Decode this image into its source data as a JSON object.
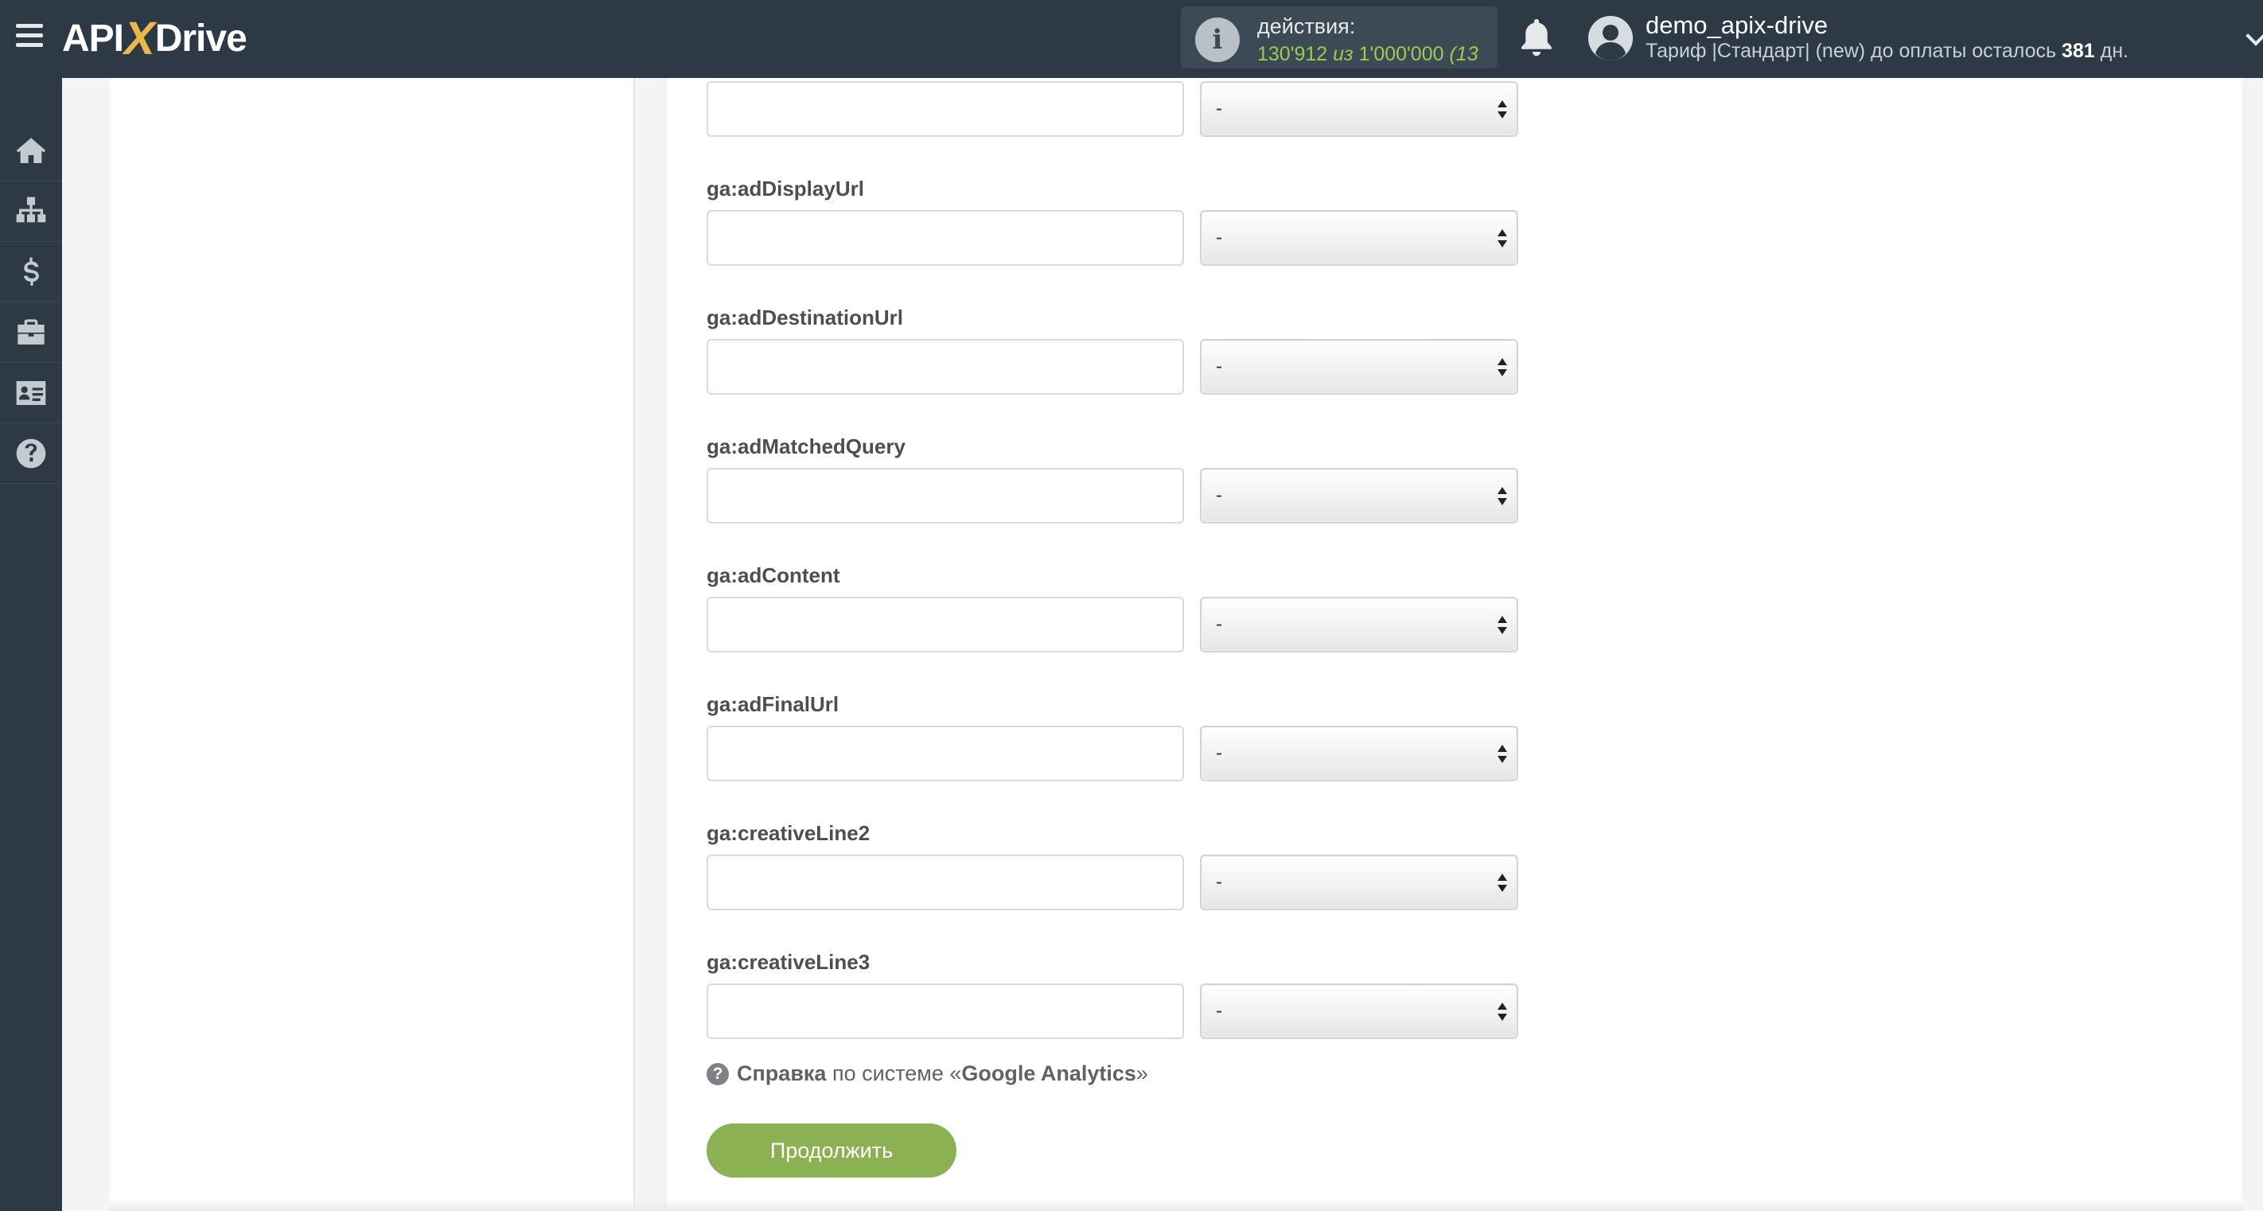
{
  "header": {
    "logo_api": "API",
    "logo_x": "X",
    "logo_drive": "Drive",
    "actions_title": "действия:",
    "actions_used": "130'912",
    "actions_of": "из",
    "actions_total": "1'000'000",
    "actions_extra": "(13",
    "user_name": "demo_apix-drive",
    "plan_text": "Тариф |Стандарт| (new) до оплаты осталось",
    "plan_days": "381",
    "plan_unit": "дн."
  },
  "sidebar": {
    "items": [
      {
        "icon": "home-icon"
      },
      {
        "icon": "sitemap-icon"
      },
      {
        "icon": "dollar-icon"
      },
      {
        "icon": "briefcase-icon"
      },
      {
        "icon": "contact-card-icon"
      },
      {
        "icon": "help-icon"
      }
    ]
  },
  "form": {
    "top_select_value": "-",
    "fields": [
      {
        "label": "ga:adDisplayUrl",
        "value": "",
        "select": "-"
      },
      {
        "label": "ga:adDestinationUrl",
        "value": "",
        "select": "-"
      },
      {
        "label": "ga:adMatchedQuery",
        "value": "",
        "select": "-"
      },
      {
        "label": "ga:adContent",
        "value": "",
        "select": "-"
      },
      {
        "label": "ga:adFinalUrl",
        "value": "",
        "select": "-"
      },
      {
        "label": "ga:creativeLine2",
        "value": "",
        "select": "-"
      },
      {
        "label": "ga:creativeLine3",
        "value": "",
        "select": "-"
      }
    ],
    "help_link": "Справка",
    "help_middle": "по системе «",
    "help_system": "Google Analytics",
    "help_end": "»",
    "continue_label": "Продолжить"
  },
  "colors": {
    "topbar": "#2d3a46",
    "accent_green": "#8cb152",
    "actions_green": "#9ccb4f"
  }
}
